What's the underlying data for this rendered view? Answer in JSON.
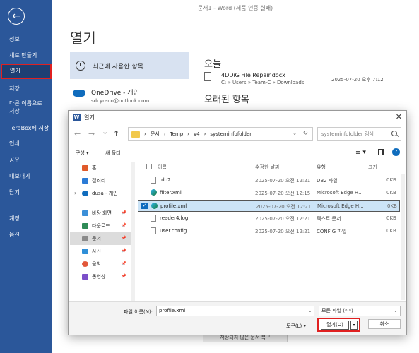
{
  "word": {
    "title": "문서1 - Word (제품 인증 실패)",
    "sidebar": {
      "items": [
        {
          "label": "정보"
        },
        {
          "label": "새로 만들기"
        },
        {
          "label": "열기"
        },
        {
          "label": "저장"
        },
        {
          "label": "다른 이름으로 저장"
        },
        {
          "label": "TeraBox에 저장"
        },
        {
          "label": "인쇄"
        },
        {
          "label": "공유"
        },
        {
          "label": "내보내기"
        },
        {
          "label": "닫기"
        },
        {
          "label": "계정"
        },
        {
          "label": "옵션"
        }
      ]
    },
    "heading": "열기",
    "recent_tab": "최근에 사용한 항목",
    "onedrive": {
      "name": "OneDrive - 개인",
      "email": "sdcyrano@outlook.com"
    },
    "today_heading": "오늘",
    "recent_file": {
      "name": "4DDiG File Repair.docx",
      "path": "C: » Users » Team-C » Downloads",
      "date": "2025-07-20 오후 7:12"
    },
    "older_heading": "오래된 항목",
    "bottom_button": "저장되지 않은 문서 복구"
  },
  "dialog": {
    "title": "열기",
    "nav": {
      "back": "←",
      "forward": "→",
      "down": "⌄",
      "up": "↑"
    },
    "address": {
      "parts": [
        "문서",
        "›",
        "Temp",
        "›",
        "v4",
        "›",
        "systeminfofolder"
      ]
    },
    "search_placeholder": "systeminfofolder 검색",
    "toolbar": {
      "organize": "구성 ▾",
      "new_folder": "새 폴더"
    },
    "nav_items": [
      {
        "label": "홈",
        "color": "#e05a2a"
      },
      {
        "label": "갤러리",
        "color": "#2b7bd6"
      },
      {
        "label": "dusa - 개인",
        "color": "#0f6cbd"
      },
      {
        "label": "바탕 화면",
        "color": "#3b8fd8"
      },
      {
        "label": "다운로드",
        "color": "#2e8b57"
      },
      {
        "label": "문서",
        "color": "#8a8a8a"
      },
      {
        "label": "사진",
        "color": "#2f8fd8"
      },
      {
        "label": "음악",
        "color": "#e2573a"
      },
      {
        "label": "동영상",
        "color": "#7b4fc9"
      }
    ],
    "columns": {
      "name": "이름",
      "date": "수정한 날짜",
      "type": "유형",
      "size": "크기"
    },
    "files": [
      {
        "name": ".db2",
        "date": "2025-07-20 오전 12:21",
        "type": "DB2 파일",
        "size": "0KB",
        "icon": "file-icon"
      },
      {
        "name": "filter.xml",
        "date": "2025-07-20 오전 12:15",
        "type": "Microsoft Edge H...",
        "size": "0KB",
        "icon": "edge-icon"
      },
      {
        "name": "profile.xml",
        "date": "2025-07-20 오전 12:21",
        "type": "Microsoft Edge H...",
        "size": "0KB",
        "icon": "edge-icon"
      },
      {
        "name": "reader4.log",
        "date": "2025-07-20 오전 12:21",
        "type": "텍스트 문서",
        "size": "0KB",
        "icon": "file-icon"
      },
      {
        "name": "user.config",
        "date": "2025-07-20 오전 12:21",
        "type": "CONFIG 파일",
        "size": "0KB",
        "icon": "file-icon"
      }
    ],
    "filename_label": "파일 이름(N):",
    "filename_value": "profile.xml",
    "filetype_value": "모든 파일 (*.*)",
    "tools": "도구(L) ▾",
    "open_button": "열기(O)",
    "cancel_button": "취소"
  }
}
